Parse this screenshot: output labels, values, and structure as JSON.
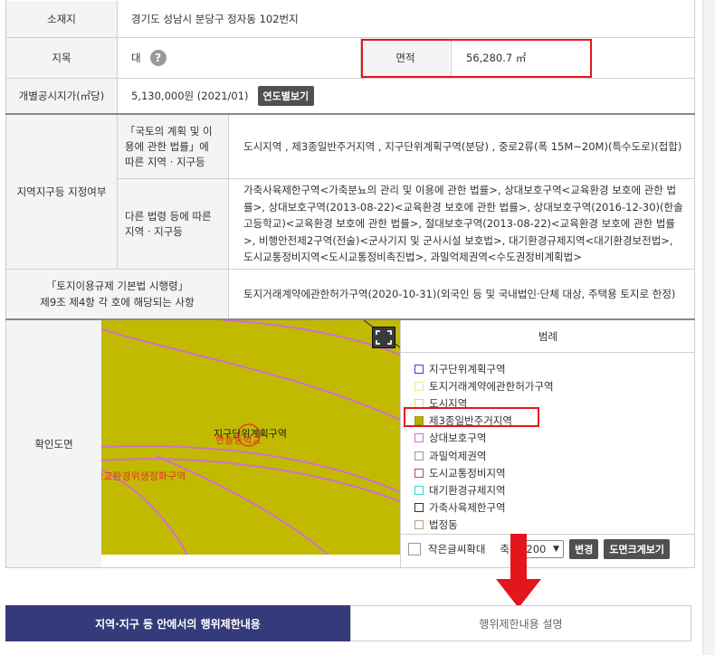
{
  "rows": {
    "location": {
      "label": "소재지",
      "value": "경기도 성남시 분당구 정자동 102번지"
    },
    "land_category": {
      "label": "지목",
      "value": "대",
      "help_icon": "question-icon"
    },
    "area": {
      "label": "면적",
      "value": "56,280.7 ㎡"
    },
    "land_price": {
      "label": "개별공시지가(㎡당)",
      "value": "5,130,000원 (2021/01)",
      "button": "연도별보기"
    },
    "zoning": {
      "label": "지역지구등 지정여부",
      "national_label": "「국토의 계획 및 이용에 관한 법률」에 따른 지역 · 지구등",
      "national_value": "도시지역 , 제3종일반주거지역 , 지구단위계획구역(분당) , 중로2류(폭 15M~20M)(특수도로)(접합)",
      "other_label": "다른 법령 등에 따른 지역 · 지구등",
      "other_value": "가축사육제한구역<가축분뇨의 관리 및 이용에 관한 법률>, 상대보호구역<교육환경 보호에 관한 법률>, 상대보호구역(2013-08-22)<교육환경 보호에 관한 법률>, 상대보호구역(2016-12-30)(한솔고등학교)<교육환경 보호에 관한 법률>, 절대보호구역(2013-08-22)<교육환경 보호에 관한 법률>, 비행안전제2구역(전술)<군사기지 및 군사시설 보호법>, 대기환경규제지역<대기환경보전법>, 도시교통정비지역<도시교통정비촉진법>, 과밀억제권역<수도권정비계획법>"
    },
    "regulation": {
      "label_line1": "「토지이용규제 기본법 시행령」",
      "label_line2": "제9조 제4항 각 호에 해당되는 사항",
      "value": "토지거래계약에관한허가구역(2020-10-31)(외국인 등 및 국내법인·단체 대상, 주택용 토지로 한정)"
    },
    "map": {
      "label": "확인도면"
    }
  },
  "map_labels": {
    "center": "지구단위계획구역",
    "overlap": "한솔중학교",
    "left": "학교환경위생정화구역"
  },
  "legend": {
    "title": "범례",
    "items": [
      {
        "label": "지구단위계획구역",
        "border": "#3a3ae0",
        "fill": "#ffffff"
      },
      {
        "label": "토지거래계약에관한허가구역",
        "border": "#f0e8a0",
        "fill": "#ffffff"
      },
      {
        "label": "도시지역",
        "border": "#e8d36a",
        "fill": "#ffffff"
      },
      {
        "label": "제3종일반주거지역",
        "border": "#9d9a10",
        "fill": "#b5b000"
      },
      {
        "label": "상대보호구역",
        "border": "#d070d0",
        "fill": "#ffffff"
      },
      {
        "label": "과밀억제권역",
        "border": "#999999",
        "fill": "#ffffff"
      },
      {
        "label": "도시교통정비지역",
        "border": "#a05070",
        "fill": "#ffffff"
      },
      {
        "label": "대기환경규제지역",
        "border": "#40d0d0",
        "fill": "#ffffff"
      },
      {
        "label": "가축사육제한구역",
        "border": "#333333",
        "fill": "#ffffff"
      },
      {
        "label": "법정동",
        "border": "#c0a080",
        "fill": "#ffffff"
      }
    ]
  },
  "controls": {
    "small_text_zoom": "작은글씨확대",
    "scale_prefix": "축",
    "scale_value": "1200",
    "change_button": "변경",
    "big_map_button": "도면크게보기"
  },
  "tabs": {
    "active": "지역·지구 등 안에서의 행위제한내용",
    "inactive": "행위제한내용 설명"
  }
}
